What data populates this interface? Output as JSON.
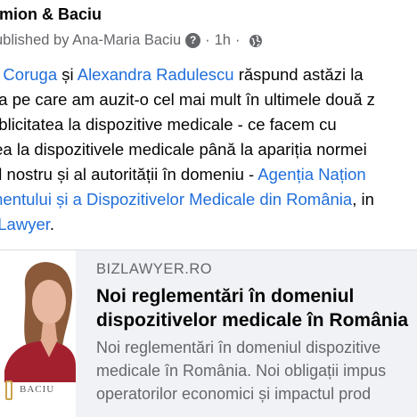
{
  "post": {
    "author": "imion & Baciu",
    "published_prefix": "ublished by Ana-Maria Baciu",
    "help_icon": "question-circle-icon",
    "separator": "·",
    "time": "1h",
    "separator2": "·",
    "audience_icon": "globe-icon",
    "body": {
      "l1_a": "a Coruga",
      "l1_b": " și ",
      "l1_c": "Alexandra Radulescu",
      "l1_d": " răspund astăzi la",
      "l2": "ea pe care am auzit-o cel mai mult în ultimele două z",
      "l3": "ublicitatea la dispozitive medicale - ce facem cu",
      "l4": "tea la dispozitivele medicale până  la apariția normei",
      "l5_a": "ul nostru și al autorității în domeniu - ",
      "l5_b": "Agenția Națion",
      "l6_a": "mentului și a Dispozitivelor Medicale din România",
      "l6_b": ", in",
      "l7_a": "zLawyer",
      "l7_b": "."
    }
  },
  "link_card": {
    "domain": "BIZLAWYER.RO",
    "title_l1": "Noi reglementări în domeniul",
    "title_l2": "dispozitivelor medicale în România",
    "desc_l1": "Noi reglementări în domeniul dispozitive",
    "desc_l2": "medicale în România. Noi obligații impus",
    "desc_l3": "operatorilor economici și impactul prod",
    "image_caption": "BACIU"
  },
  "colors": {
    "link": "#216fdb",
    "secondary_text": "#65676b",
    "card_background": "#f0f2f5"
  }
}
